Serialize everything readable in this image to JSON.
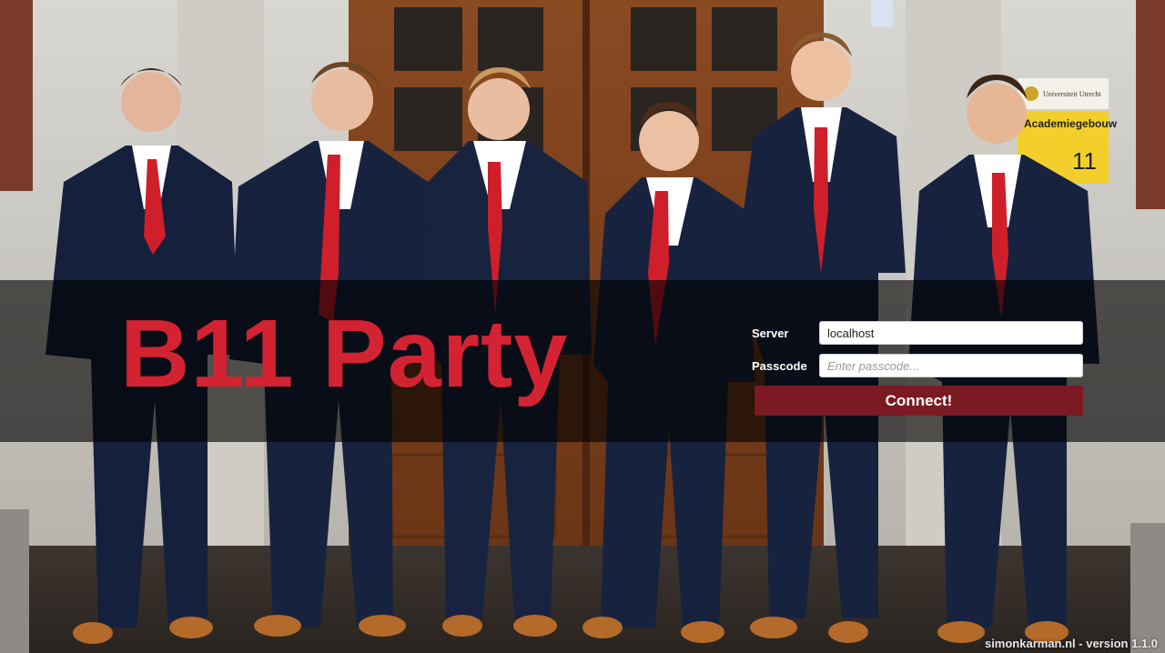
{
  "app": {
    "title": "B11 Party",
    "accent_color": "#d32232"
  },
  "login": {
    "server_label": "Server",
    "server_value": "localhost",
    "passcode_label": "Passcode",
    "passcode_placeholder": "Enter passcode...",
    "connect_label": "Connect!",
    "connect_color": "#7b1a22"
  },
  "footer": {
    "credit": "simonkarman.nl - version 1.1.0"
  },
  "background": {
    "sign_text": "Academiegebouw",
    "sign_number": "11",
    "sign_header": "Universiteit Utrecht"
  }
}
